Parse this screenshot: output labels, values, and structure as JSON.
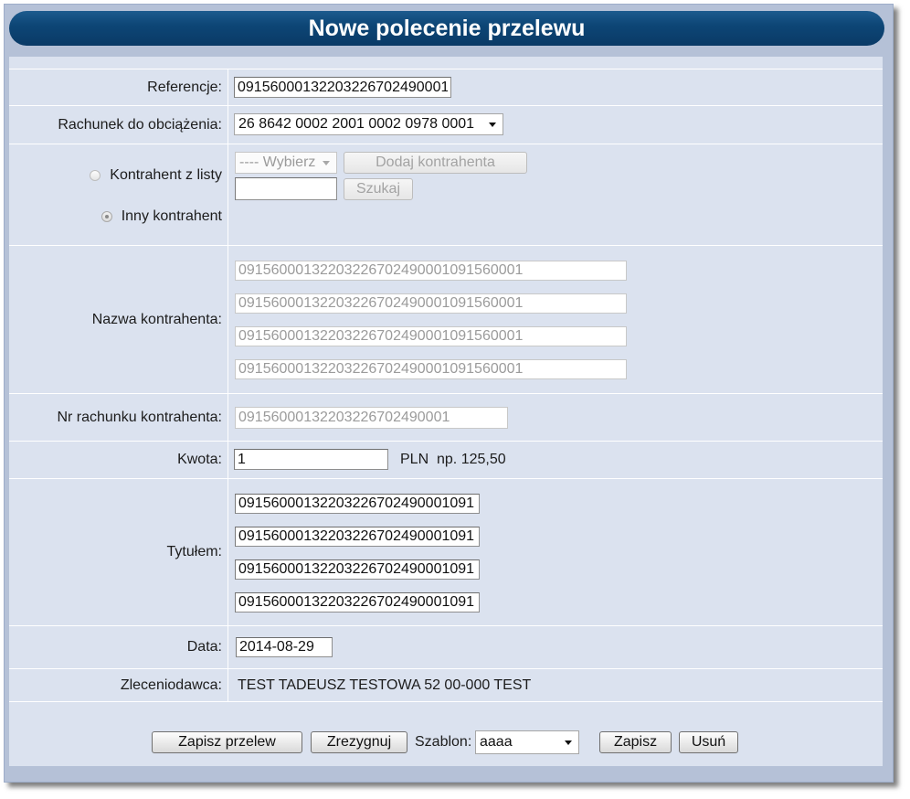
{
  "window": {
    "title": "Nowe polecenie przelewu"
  },
  "form": {
    "reference": {
      "label": "Referencje:",
      "value": "09156000132203226702490001"
    },
    "debit_account": {
      "label": "Rachunek do obciążenia:",
      "value": "26 8642 0002 2001 0002 0978 0001"
    },
    "counterparty": {
      "from_list_label": "Kontrahent z listy",
      "from_list_checked": false,
      "other_label": "Inny kontrahent",
      "other_checked": true,
      "list_select_value": "---- Wybierz",
      "add_button_label": "Dodaj kontrahenta",
      "search_value": "",
      "search_button_label": "Szukaj"
    },
    "counterparty_name": {
      "label": "Nazwa kontrahenta:",
      "lines": [
        "09156000132203226702490001091560001",
        "09156000132203226702490001091560001",
        "09156000132203226702490001091560001",
        "09156000132203226702490001091560001"
      ]
    },
    "counterparty_account": {
      "label": "Nr rachunku kontrahenta:",
      "value": "09156000132203226702490001"
    },
    "amount": {
      "label": "Kwota:",
      "value": "1",
      "currency": "PLN",
      "hint": "np. 125,50"
    },
    "transfer_title": {
      "label": "Tytułem:",
      "lines": [
        "09156000132203226702490001091",
        "09156000132203226702490001091",
        "09156000132203226702490001091",
        "09156000132203226702490001091"
      ]
    },
    "date": {
      "label": "Data:",
      "value": "2014-08-29"
    },
    "principal": {
      "label": "Zleceniodawca:",
      "value": "TEST TADEUSZ TESTOWA 52 00-000 TEST"
    }
  },
  "actions": {
    "save_transfer_label": "Zapisz przelew",
    "cancel_label": "Zrezygnuj",
    "template_label": "Szablon:",
    "template_value": "aaaa",
    "save_template_label": "Zapisz",
    "delete_template_label": "Usuń"
  },
  "icons": {
    "dropdown_arrow": "chevron-down-icon"
  },
  "colors": {
    "header_bg": "#0d4676",
    "frame_bg": "#b5c1d7",
    "panel_bg": "#dbe2ef",
    "title_text": "#ffffff",
    "separator": "#ffffff",
    "disabled_text": "#9b9b9b"
  }
}
